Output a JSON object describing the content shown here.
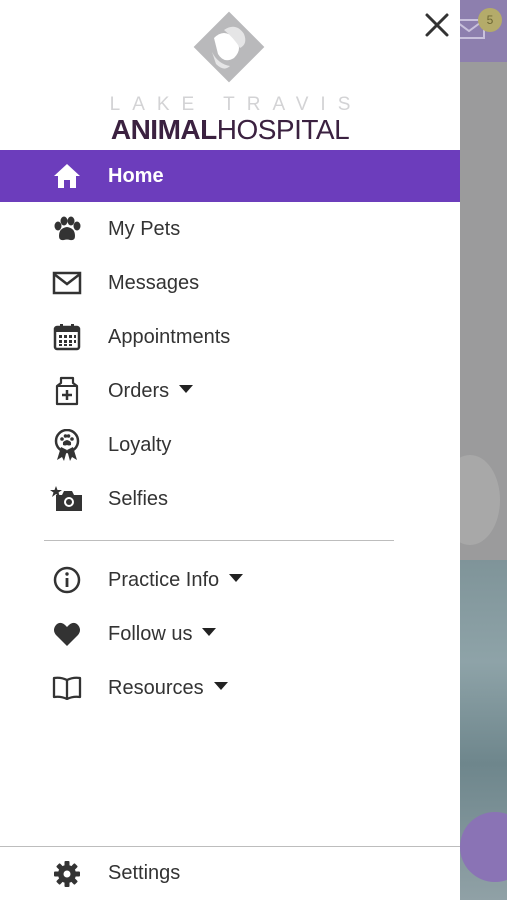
{
  "background": {
    "mail_badge_count": "5",
    "colors": {
      "topbar": "#8d7fae",
      "overlay": "#8e8e90",
      "fab": "#8a73b5"
    }
  },
  "drawer": {
    "close_icon": "close-icon",
    "logo": {
      "line1": "LAKE TRAVIS",
      "line2_bold": "ANIMAL",
      "line2_regular": "HOSPITAL"
    },
    "accent_color": "#6c3dbc",
    "menu": [
      {
        "label": "Home",
        "icon": "home-icon",
        "active": true,
        "dropdown": false
      },
      {
        "label": "My Pets",
        "icon": "paw-icon",
        "active": false,
        "dropdown": false
      },
      {
        "label": "Messages",
        "icon": "envelope-icon",
        "active": false,
        "dropdown": false
      },
      {
        "label": "Appointments",
        "icon": "calendar-icon",
        "active": false,
        "dropdown": false
      },
      {
        "label": "Orders",
        "icon": "medicine-bag-icon",
        "active": false,
        "dropdown": true
      },
      {
        "label": "Loyalty",
        "icon": "ribbon-paw-icon",
        "active": false,
        "dropdown": false
      },
      {
        "label": "Selfies",
        "icon": "camera-star-icon",
        "active": false,
        "dropdown": false
      }
    ],
    "menu_secondary": [
      {
        "label": "Practice Info",
        "icon": "info-icon",
        "dropdown": true
      },
      {
        "label": "Follow us",
        "icon": "heart-icon",
        "dropdown": true
      },
      {
        "label": "Resources",
        "icon": "book-icon",
        "dropdown": true
      }
    ],
    "footer": {
      "label": "Settings",
      "icon": "gear-icon"
    }
  }
}
